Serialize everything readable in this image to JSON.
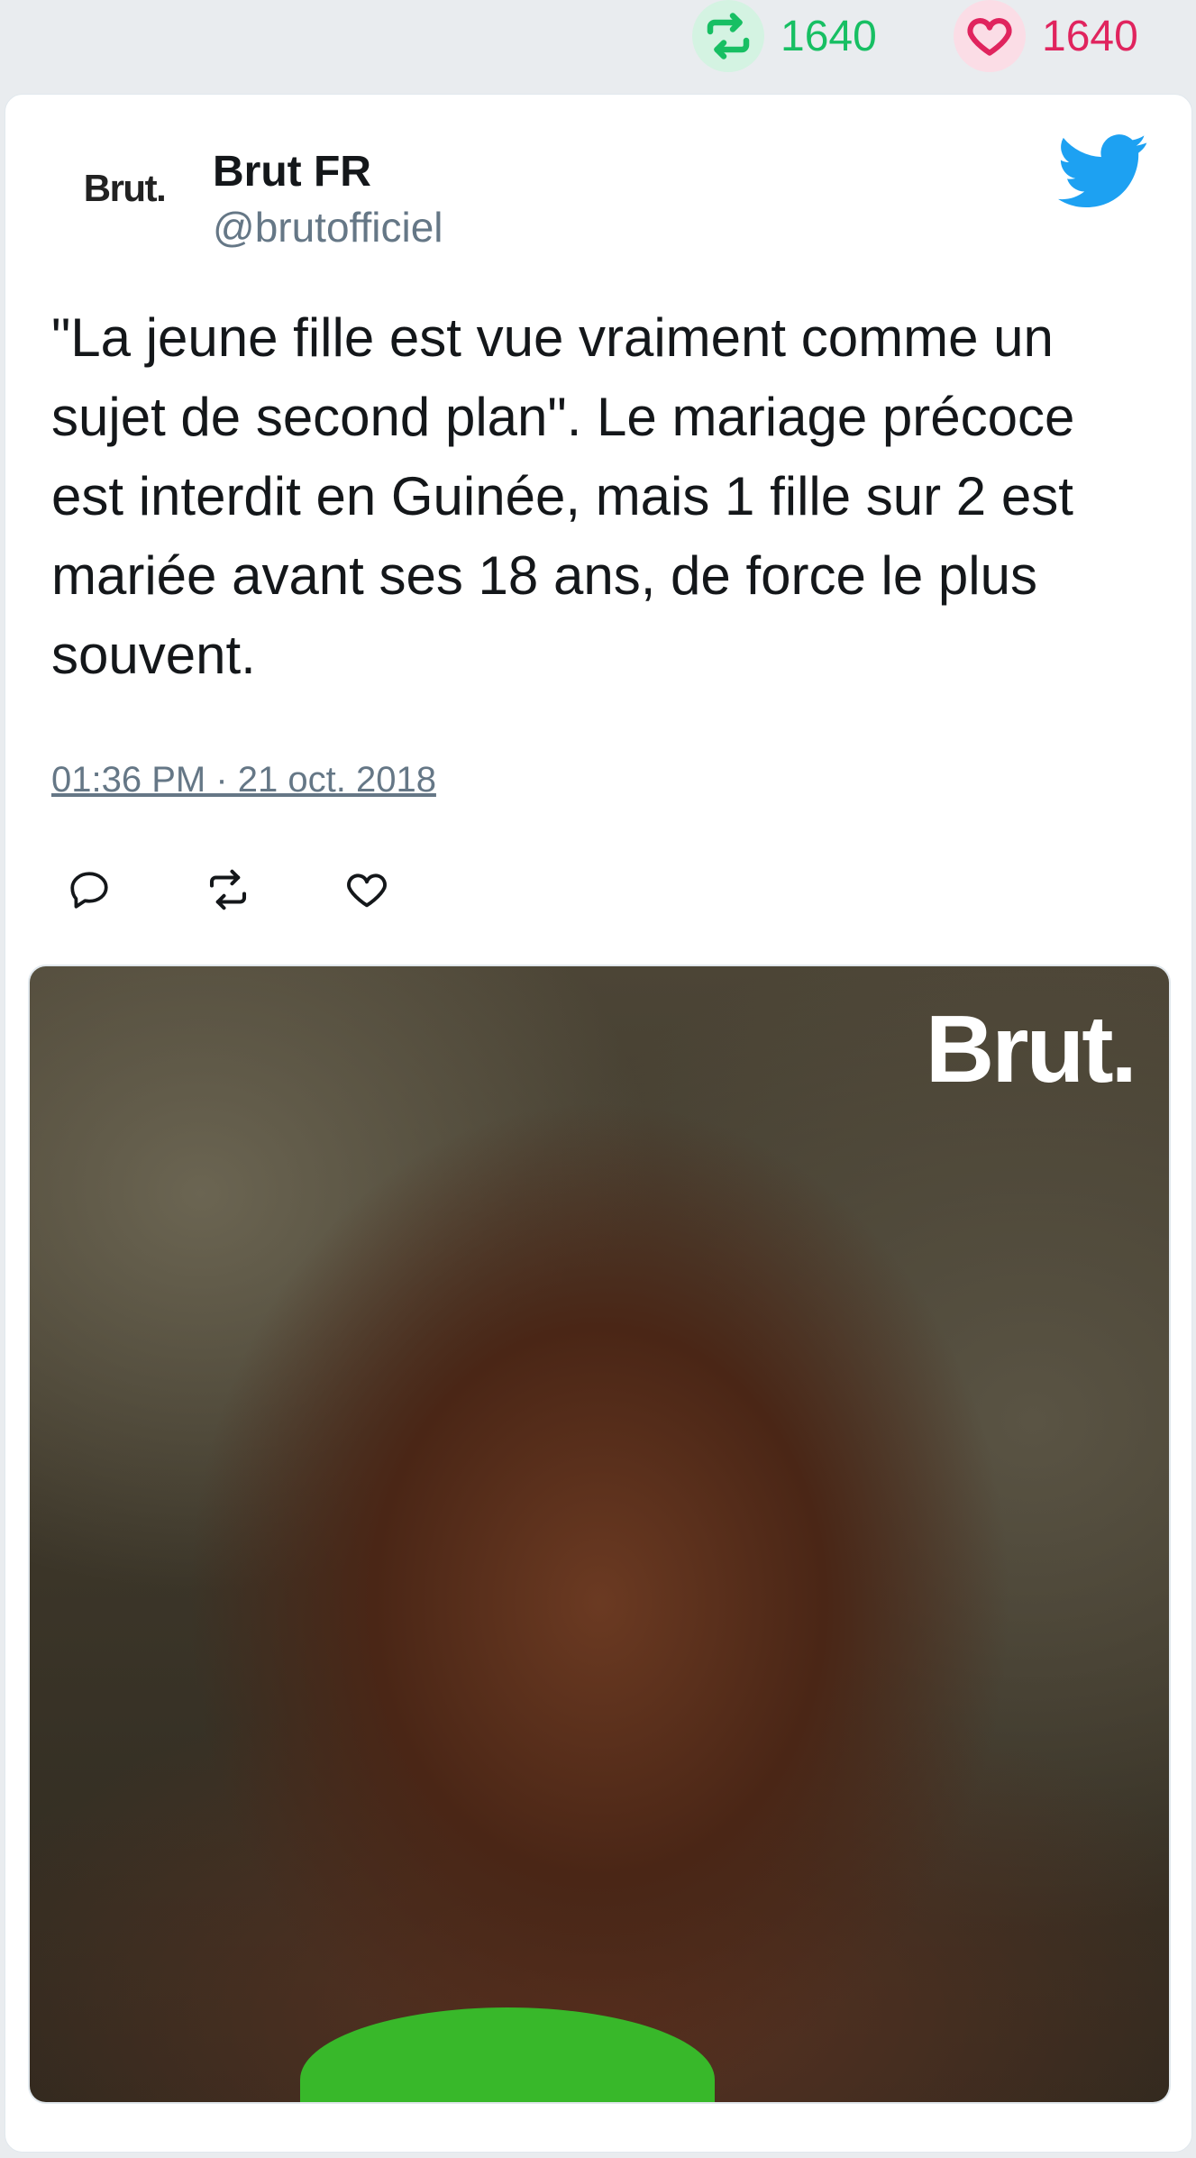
{
  "stats": {
    "retweets": "1640",
    "likes": "1640"
  },
  "author": {
    "avatar_text": "Brut.",
    "name": "Brut FR",
    "handle": "@brutofficiel"
  },
  "tweet": {
    "text": "\"La jeune fille est vue vraiment comme un sujet de second plan\". Le mariage précoce est interdit en Guinée, mais 1 fille sur 2 est mariée avant ses 18 ans, de force le plus souvent.",
    "timestamp": "01:36 PM · 21 oct. 2018"
  },
  "media": {
    "watermark": "Brut."
  },
  "icons": {
    "retweet": "retweet-icon",
    "like": "heart-icon",
    "reply": "reply-icon",
    "brand": "twitter-bird-icon"
  },
  "colors": {
    "retweet": "#17bf63",
    "like": "#e0245e",
    "twitter": "#1da1f2",
    "text": "#14171a",
    "muted": "#657786"
  }
}
